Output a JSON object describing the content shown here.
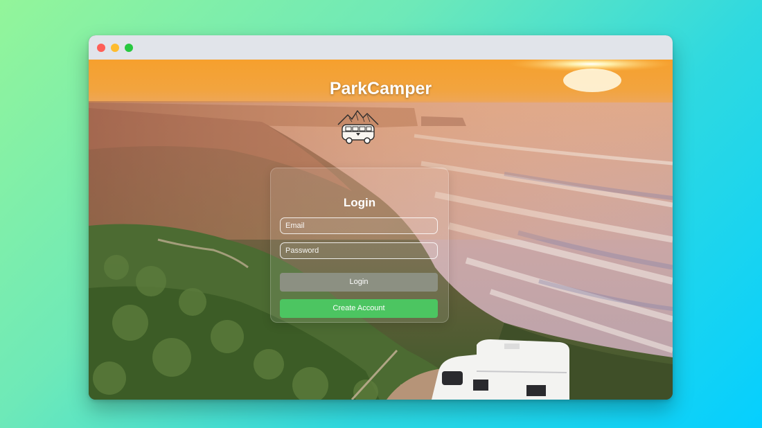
{
  "window": {
    "controls": [
      "close",
      "minimize",
      "maximize"
    ]
  },
  "brand": {
    "title": "ParkCamper",
    "logo_icon": "campervan-mountain-logo-icon"
  },
  "login": {
    "heading": "Login",
    "email_placeholder": "Email",
    "password_placeholder": "Password",
    "login_label": "Login",
    "create_account_label": "Create Account"
  },
  "colors": {
    "login_button": "#8c9082",
    "create_account_button": "#4cc561",
    "close_dot": "#fe5f57",
    "minimize_dot": "#febc2e",
    "maximize_dot": "#28c840"
  }
}
